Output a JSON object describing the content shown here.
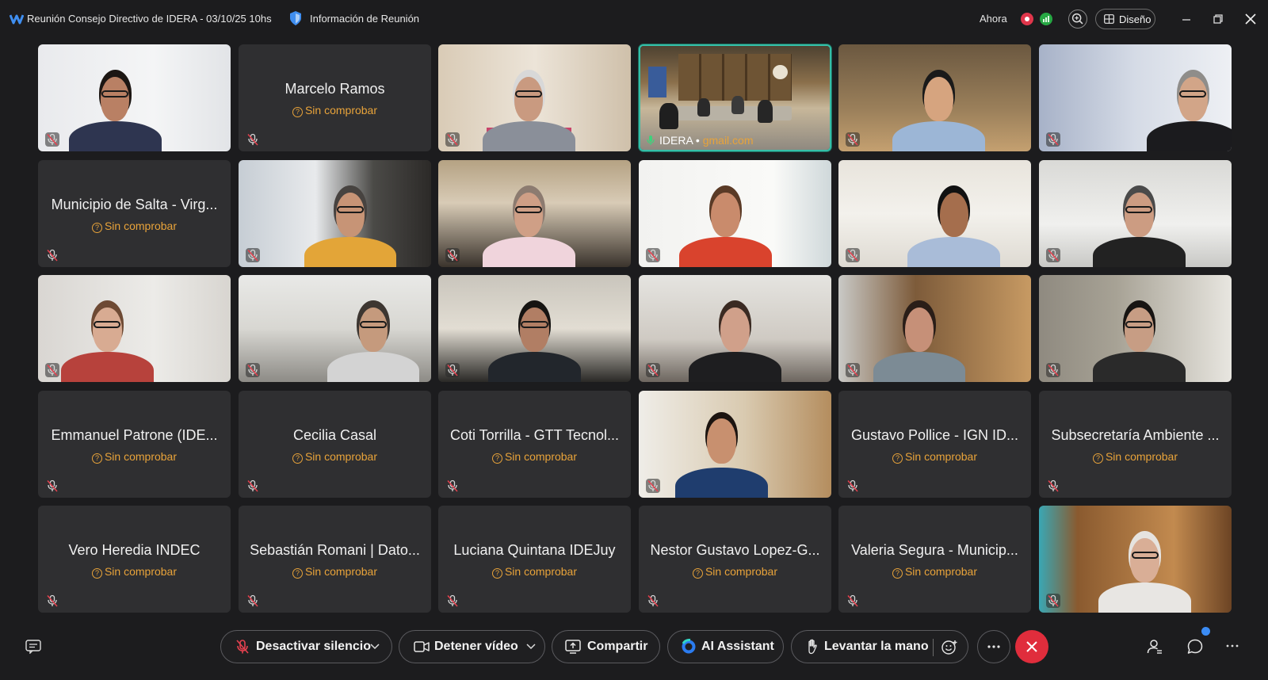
{
  "window": {
    "title": "Reunión Consejo Directivo de IDERA - 03/10/25 10hs",
    "info_label": "Información de Reunión",
    "now_label": "Ahora",
    "design_label": "Diseño"
  },
  "tiles": [
    {
      "type": "video",
      "name": ""
    },
    {
      "type": "named",
      "name": "Marcelo Ramos",
      "status": "Sin comprobar"
    },
    {
      "type": "video",
      "name": ""
    },
    {
      "type": "video",
      "name": "IDERA",
      "email": "gmail.com",
      "active": true
    },
    {
      "type": "video",
      "name": ""
    },
    {
      "type": "video",
      "name": ""
    },
    {
      "type": "named",
      "name": "Municipio de Salta - Virg...",
      "status": "Sin comprobar"
    },
    {
      "type": "video",
      "name": ""
    },
    {
      "type": "video",
      "name": ""
    },
    {
      "type": "video",
      "name": ""
    },
    {
      "type": "video",
      "name": ""
    },
    {
      "type": "video",
      "name": ""
    },
    {
      "type": "video",
      "name": ""
    },
    {
      "type": "video",
      "name": ""
    },
    {
      "type": "video",
      "name": ""
    },
    {
      "type": "video",
      "name": ""
    },
    {
      "type": "video",
      "name": ""
    },
    {
      "type": "video",
      "name": ""
    },
    {
      "type": "named",
      "name": "Emmanuel Patrone (IDE...",
      "status": "Sin comprobar"
    },
    {
      "type": "named",
      "name": "Cecilia Casal",
      "status": "Sin comprobar"
    },
    {
      "type": "named",
      "name": "Coti Torrilla - GTT Tecnol...",
      "status": "Sin comprobar"
    },
    {
      "type": "video",
      "name": ""
    },
    {
      "type": "named",
      "name": "Gustavo Pollice - IGN ID...",
      "status": "Sin comprobar"
    },
    {
      "type": "named",
      "name": "Subsecretaría Ambiente ...",
      "status": "Sin comprobar"
    },
    {
      "type": "named",
      "name": "Vero Heredia INDEC",
      "status": "Sin comprobar"
    },
    {
      "type": "named",
      "name": "Sebastián Romani | Dato...",
      "status": "Sin comprobar"
    },
    {
      "type": "named",
      "name": "Luciana Quintana IDEJuy",
      "status": "Sin comprobar"
    },
    {
      "type": "named",
      "name": "Nestor Gustavo Lopez-G...",
      "status": "Sin comprobar"
    },
    {
      "type": "named",
      "name": "Valeria Segura - Municip...",
      "status": "Sin comprobar"
    },
    {
      "type": "video",
      "name": ""
    }
  ],
  "toolbar": {
    "mute_label": "Desactivar silencio",
    "video_label": "Detener vídeo",
    "share_label": "Compartir",
    "ai_label": "AI Assistant",
    "hand_label": "Levantar la mano"
  }
}
